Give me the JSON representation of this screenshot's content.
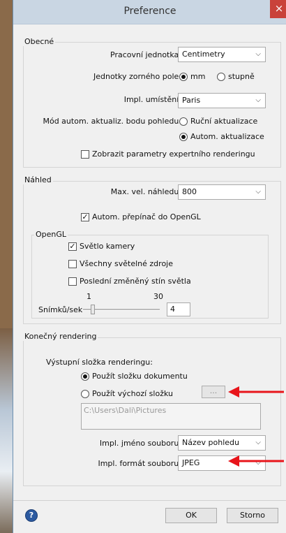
{
  "window": {
    "title": "Preference",
    "close_glyph": "×"
  },
  "general": {
    "legend": "Obecné",
    "unit_label": "Pracovní jednotka:",
    "unit_value": "Centimetry",
    "fov_units_label": "Jednotky zorného pole:",
    "fov_option_mm": "mm",
    "fov_option_deg": "stupně",
    "location_label": "Impl. umístění:",
    "location_value": "Paris",
    "update_mode_label": "Mód autom. aktualiz. bodu pohledu:",
    "update_manual": "Ruční aktualizace",
    "update_auto": "Autom. aktualizace",
    "expert_render_label": "Zobrazit parametry expertního renderingu"
  },
  "preview": {
    "legend": "Náhled",
    "max_size_label": "Max. vel. náhledu:",
    "max_size_value": "800",
    "auto_opengl_label": "Autom. přepínač do OpenGL",
    "opengl": {
      "legend": "OpenGL",
      "camera_light": "Světlo kamery",
      "all_lights": "Všechny světelné zdroje",
      "last_shadow": "Poslední změněný stín světla",
      "fps_min": "1",
      "fps_max": "30",
      "fps_label": "Snímků/sek",
      "fps_value": "4"
    }
  },
  "final": {
    "legend": "Konečný rendering",
    "output_folder_label": "Výstupní složka renderingu:",
    "use_doc_folder": "Použít složku dokumentu",
    "use_default_folder": "Použít výchozí složku",
    "browse_label": "...",
    "path_value": "C:\\Users\\Dali\\Pictures",
    "filename_label": "Impl. jméno souboru:",
    "filename_value": "Název pohledu",
    "format_label": "Impl. formát souboru:",
    "format_value": "JPEG"
  },
  "footer": {
    "ok": "OK",
    "cancel": "Storno",
    "help_glyph": "?"
  },
  "colors": {
    "annotation_arrow": "#e8151b",
    "titlebar": "#c9d6e3",
    "close": "#c9423a"
  }
}
